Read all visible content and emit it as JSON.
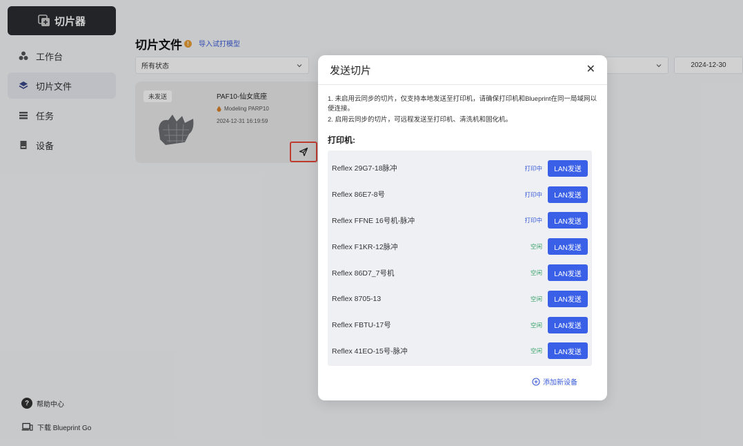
{
  "app": {
    "logo_label": "切片器"
  },
  "sidebar": {
    "items": [
      {
        "label": "工作台",
        "icon": "dots-icon",
        "active": false
      },
      {
        "label": "切片文件",
        "icon": "layers-icon",
        "active": true
      },
      {
        "label": "任务",
        "icon": "list-icon",
        "active": false
      },
      {
        "label": "设备",
        "icon": "device-icon",
        "active": false
      }
    ],
    "footer": {
      "help": "帮助中心",
      "download": "下载 Blueprint Go"
    }
  },
  "main": {
    "title": "切片文件",
    "import_link": "导入试打模型",
    "filters": {
      "status": "所有状态",
      "date": "2024-12-30"
    },
    "card": {
      "status": "未发送",
      "name": "PAF10-仙女底座",
      "model": "Modeling PARP10",
      "time": "2024-12-31 16:19:59"
    }
  },
  "modal": {
    "title": "发送切片",
    "notes": [
      "1. 未启用云同步的切片，仅支持本地发送至打印机，请确保打印机和Blueprint在同一局域网以便连接。",
      "2. 启用云同步的切片，可远程发送至打印机、清洗机和固化机。"
    ],
    "section_label": "打印机:",
    "printers": [
      {
        "name": "Reflex 29G7-18脉冲",
        "status": "打印中",
        "state": "busy",
        "button": "LAN发送"
      },
      {
        "name": "Reflex 86E7-8号",
        "status": "打印中",
        "state": "busy",
        "button": "LAN发送"
      },
      {
        "name": "Reflex FFNE 16号机-脉冲",
        "status": "打印中",
        "state": "busy",
        "button": "LAN发送"
      },
      {
        "name": "Reflex F1KR-12脉冲",
        "status": "空闲",
        "state": "idle",
        "button": "LAN发送"
      },
      {
        "name": "Reflex 86D7_7号机",
        "status": "空闲",
        "state": "idle",
        "button": "LAN发送"
      },
      {
        "name": "Reflex 8705-13",
        "status": "空闲",
        "state": "idle",
        "button": "LAN发送"
      },
      {
        "name": "Reflex FBTU-17号",
        "status": "空闲",
        "state": "idle",
        "button": "LAN发送"
      },
      {
        "name": "Reflex 41EO-15号-脉冲",
        "status": "空闲",
        "state": "idle",
        "button": "LAN发送"
      }
    ],
    "add_device": "添加新设备"
  },
  "colors": {
    "accent": "#3a60e8",
    "busy": "#3a5bd9",
    "idle": "#3aa36b",
    "highlight": "#e8483b"
  }
}
